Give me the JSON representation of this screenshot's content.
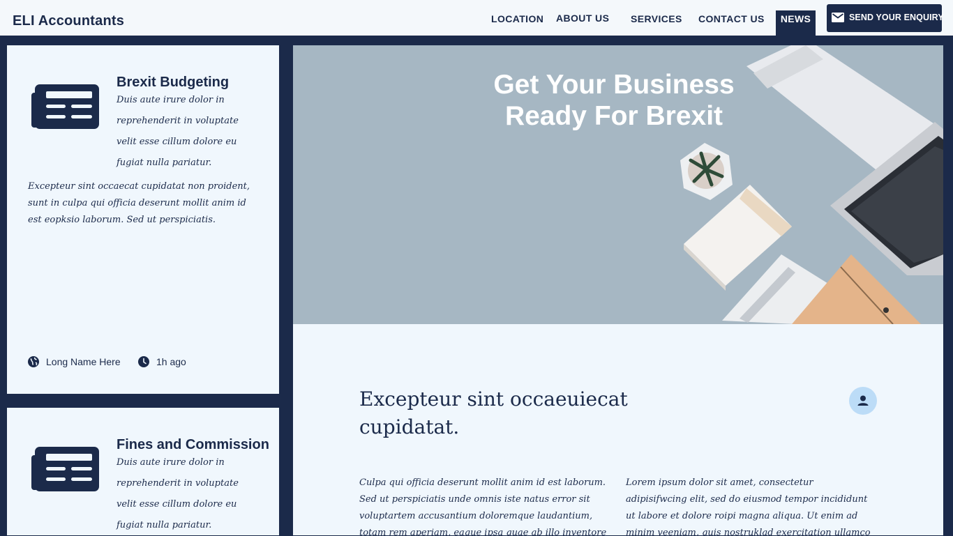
{
  "header": {
    "brand": "ELI Accountants",
    "nav": [
      "LOCATION",
      "ABOUT US",
      "SERVICES",
      "CONTACT US",
      "NEWS"
    ],
    "active_nav": "NEWS",
    "enquiry_label": "SEND YOUR ENQUIRY",
    "enquiry_icon": "mail-icon"
  },
  "cards": [
    {
      "icon": "newspaper-icon",
      "title": "Brexit Budgeting",
      "excerpt": "Duis aute irure dolor in reprehenderit in voluptate velit esse cillum dolore eu fugiat nulla pariatur.",
      "body": "Excepteur sint occaecat cupidatat non proident, sunt in culpa qui officia deserunt mollit anim id est eopksio laborum. Sed ut perspiciatis.",
      "author": "Long Name Here",
      "time": "1h ago"
    },
    {
      "icon": "newspaper-icon",
      "title": "Fines and Commission",
      "excerpt": "Duis aute irure dolor in reprehenderit in voluptate velit esse cillum dolore eu fugiat nulla pariatur."
    }
  ],
  "hero": {
    "title": "Get Your Business Ready For Brexit"
  },
  "article": {
    "heading": "Excepteur sint occaeuiecat cupidatat.",
    "col1": "Culpa qui officia deserunt mollit anim id est laborum. Sed ut perspiciatis unde omnis iste natus error sit voluptartem accusantium doloremque laudantium, totam rem aperiam, eaque ipsa quae ab illo inventore",
    "col2": "Lorem ipsum dolor sit amet, consectetur adipisifwcing elit, sed do eiusmod tempor incididunt ut labore et dolore roipi magna aliqua. Ut enim ad minim veeniam, quis nostruklad exercitation ullamco laboris nisi ut aliquip ex"
  },
  "colors": {
    "navy": "#1b2a4a",
    "card_bg": "#f0f7fd",
    "hero_bg": "#a6b7c3",
    "avatar_bg": "#bcdcf7"
  }
}
